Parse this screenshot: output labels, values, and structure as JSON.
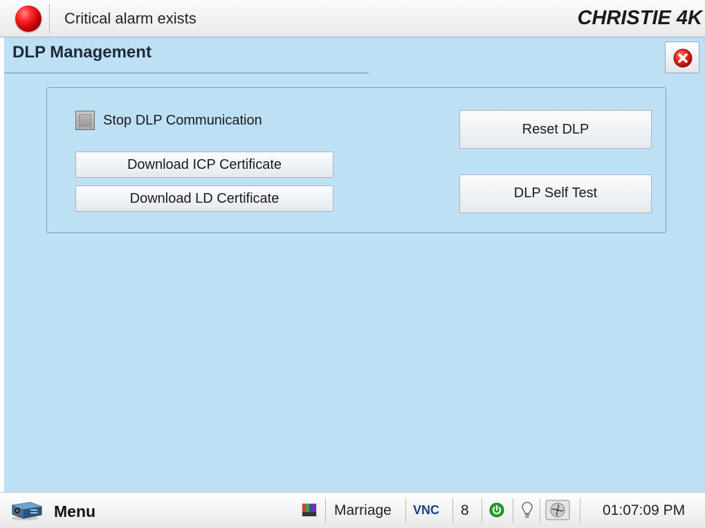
{
  "header": {
    "alarm_text": "Critical alarm exists",
    "alarm_color": "#e00000",
    "brand": "CHRISTIE 4K",
    "brand_color": "#1a1a1a"
  },
  "page": {
    "title": "DLP Management",
    "background_color": "#bde0f5"
  },
  "controls": {
    "stop_comm_label": "Stop DLP Communication",
    "stop_comm_checked": false,
    "download_icp_label": "Download ICP Certificate",
    "download_ld_label": "Download LD Certificate",
    "reset_dlp_label": "Reset DLP",
    "self_test_label": "DLP Self Test"
  },
  "icons": {
    "alarm": "alarm-led-icon",
    "close": "close-icon",
    "menu": "projector-icon",
    "test_pattern": "test-pattern-icon",
    "power": "power-icon",
    "lamp": "lamp-icon",
    "fan": "fan-icon"
  },
  "statusbar": {
    "menu_label": "Menu",
    "channel_name": "Marriage",
    "vnc_label": "VNC",
    "channel_number": "8",
    "power_color": "#22a022",
    "time": "01:07:09 PM"
  }
}
